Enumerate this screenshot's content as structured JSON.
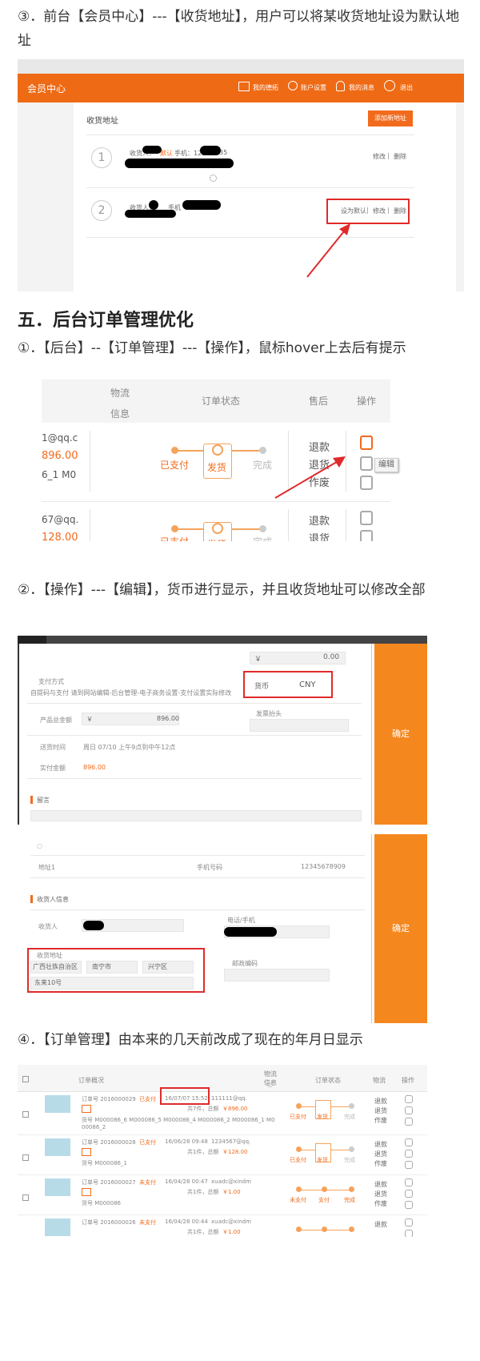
{
  "sections": {
    "s1": "③．前台【会员中心】---【收货地址】，用户可以将某收货地址设为默认地址",
    "h5": "五．后台订单管理优化",
    "s2": "①．【后台】--【订单管理】---【操作】，鼠标hover上去后有提示",
    "s3": "②．【操作】---【编辑】，货币进行显示，并且收货地址可以修改全部",
    "s4": "④．【订单管理】由本来的几天前改成了现在的年月日显示"
  },
  "member": {
    "header_title": "会员中心",
    "nav": [
      "我的德拓",
      "账户设置",
      "我的消息",
      "退出"
    ],
    "page_title": "收货地址",
    "add_button": "添加新地址",
    "addresses": [
      {
        "index": "1",
        "receiver_label": "收货人：",
        "receiver_tag": "默认",
        "phone_label": "手机：123",
        "phone_tail": "35",
        "actions": [
          "修改",
          "删除"
        ]
      },
      {
        "index": "2",
        "receiver_label": "收货人：",
        "phone_label": "手机",
        "actions": [
          "设为默认",
          "修改",
          "删除"
        ]
      }
    ]
  },
  "order_hover": {
    "headers": [
      "物流信息",
      "订单状态",
      "售后",
      "操作"
    ],
    "rows": [
      {
        "email": "1@qq.c",
        "amount": "896.00",
        "code": "6_1 M0",
        "steps": [
          "已支付",
          "发货",
          "完成"
        ],
        "after": [
          "退款",
          "退货",
          "作废"
        ]
      },
      {
        "email": "67@qq.",
        "amount": "128.00",
        "steps": [
          "已支付",
          "发货",
          "完成"
        ],
        "after": [
          "退款",
          "退货"
        ]
      }
    ],
    "tooltip": "编辑"
  },
  "edit1": {
    "currency_symbol": "￥",
    "top_value": "0.00",
    "pay_method_label": "支付方式",
    "pay_method_desc": "自提码与支付   请到网站编辑-后台管理-电子商务设置-支付设置实际修改",
    "currency_label": "货币",
    "currency_value": "CNY",
    "invoice_label": "发票抬头",
    "product_total_label": "产品总金额",
    "product_total": "896.00",
    "delivery_label": "送货时间",
    "delivery_value": "周日 07/10 上午9点到中午12点",
    "paid_label": "实付金额",
    "paid_value": "896.00",
    "remark_label": "留言",
    "confirm": "确定"
  },
  "edit2": {
    "address1_label": "地址1",
    "phone_label": "手机号码",
    "phone_value": "12345678909",
    "receiver_section": "收货人信息",
    "receiver_label": "收货人",
    "tel_label": "电话/手机",
    "address_label": "收货地址",
    "province": "广西壮族自治区",
    "city": "南宁市",
    "district": "兴宁区",
    "street": "东来10号",
    "postcode_label": "邮政编码",
    "confirm": "确定"
  },
  "order_list": {
    "headers": [
      "订单概况",
      "物流信息",
      "订单状态",
      "物流",
      "操作"
    ],
    "rows": [
      {
        "order": "订单号 2016000029",
        "status": "已支付",
        "date": "16/07/07 15:52",
        "email": "111111@qq.",
        "summary": "共7件，总额",
        "total": "￥896.00",
        "codes": "货号 M000086_6 M000086_5 M000086_4 M000086_2 M000086_1 M0",
        "codes2": "00086_2",
        "steps": [
          "已支付",
          "发货",
          "完成"
        ],
        "after": [
          "退款",
          "退货",
          "作废"
        ]
      },
      {
        "order": "订单号 2016000028",
        "status": "已支付",
        "date": "16/06/28 09:48",
        "email": "1234567@qq.",
        "summary": "共1件，总额",
        "total": "￥128.00",
        "codes": "货号 M000086_1",
        "steps": [
          "已支付",
          "发货",
          "完成"
        ],
        "after": [
          "退款",
          "退货",
          "作废"
        ]
      },
      {
        "order": "订单号 2016000027",
        "status": "未支付",
        "date": "16/04/28 00:47",
        "email": "xuadc@xindm",
        "summary": "共1件，总额",
        "total": "￥1.00",
        "codes": "货号 M000086",
        "steps": [
          "未支付",
          "支付",
          "完成"
        ],
        "after": [
          "退款",
          "退货",
          "作废"
        ]
      },
      {
        "order": "订单号 2016000026",
        "status": "未支付",
        "date": "16/04/28 00:44",
        "email": "xuadc@xindm",
        "summary": "共1件，总额",
        "total": "￥1.00",
        "after": [
          "退款"
        ]
      }
    ]
  }
}
